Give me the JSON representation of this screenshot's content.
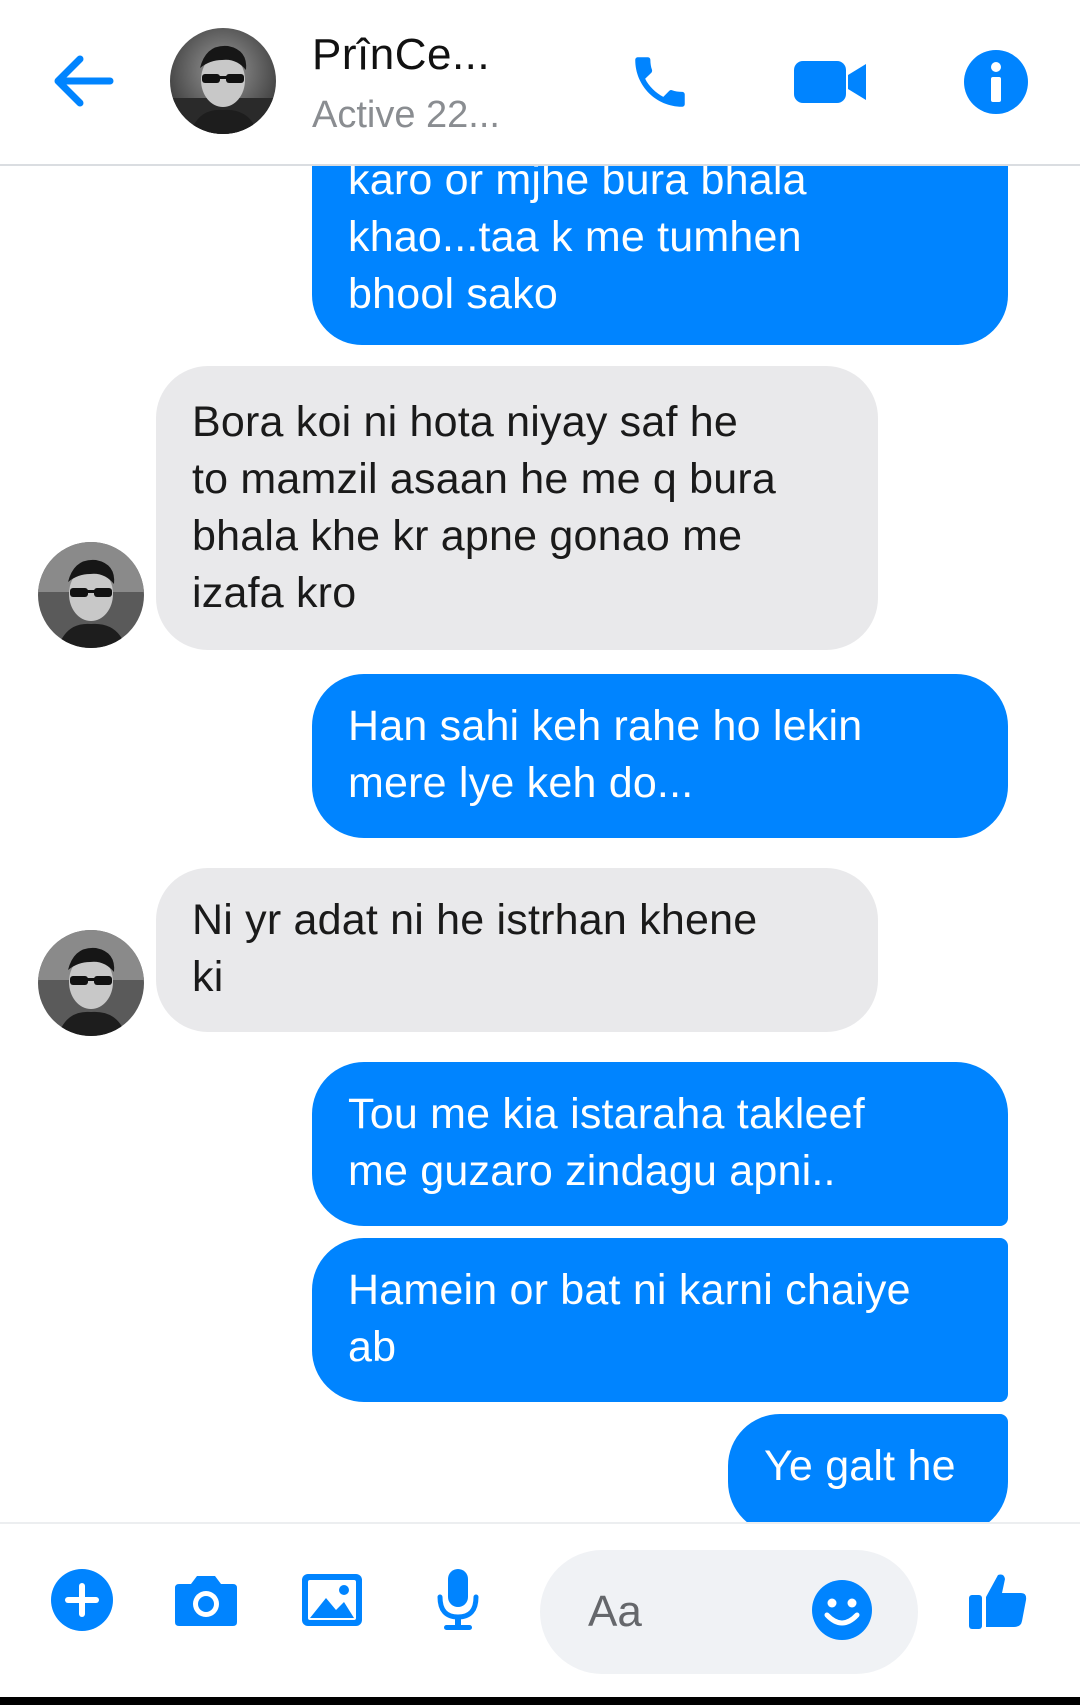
{
  "header": {
    "contact_name": "PrînCe...",
    "status": "Active 22...",
    "icons": [
      "back-arrow-icon",
      "phone-icon",
      "video-camera-icon",
      "info-icon"
    ]
  },
  "colors": {
    "accent": "#0084ff",
    "incoming_bubble": "#e9e9eb",
    "header_border": "#dadde1"
  },
  "messages": [
    {
      "direction": "outgoing",
      "lines": [
        "karo or mjhe bura bhala",
        "khao...taa k me tumhen",
        "bhool sako"
      ]
    },
    {
      "direction": "incoming",
      "lines": [
        "Bora koi ni hota niyay saf he",
        "to mamzil asaan he me q bura",
        "bhala khe kr apne gonao me",
        "izafa kro"
      ]
    },
    {
      "direction": "outgoing",
      "lines": [
        "Han sahi keh rahe ho lekin",
        "mere lye keh do..."
      ]
    },
    {
      "direction": "incoming",
      "lines": [
        "Ni yr adat ni he istrhan khene",
        "ki"
      ]
    },
    {
      "direction": "outgoing",
      "lines": [
        "Tou me kia istaraha takleef",
        "me guzaro zindagu apni.."
      ]
    },
    {
      "direction": "outgoing",
      "lines": [
        "Hamein or bat ni karni chaiye",
        "ab"
      ]
    },
    {
      "direction": "outgoing",
      "lines": [
        "Ye galt he"
      ]
    }
  ],
  "composer": {
    "placeholder": "Aa",
    "icons": [
      "plus-icon",
      "camera-icon",
      "gallery-icon",
      "microphone-icon",
      "emoji-icon",
      "thumbs-up-icon"
    ]
  }
}
